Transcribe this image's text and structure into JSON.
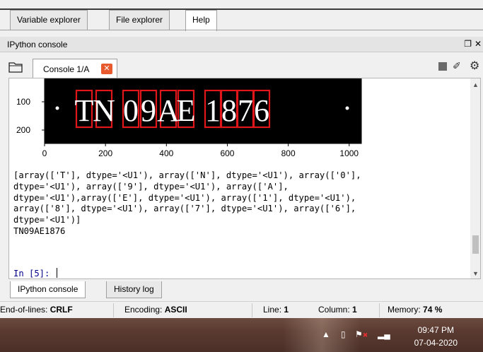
{
  "top_tabs": [
    {
      "label": "Variable explorer"
    },
    {
      "label": "File explorer"
    },
    {
      "label": "Help"
    }
  ],
  "pane": {
    "title": "IPython console",
    "undock_icon": "undock-icon",
    "close_icon": "close-icon"
  },
  "console_tab": {
    "label": "Console 1/A",
    "close_label": "✕"
  },
  "plot": {
    "plate_text": "TN 09 AE 1876",
    "characters": [
      "T",
      "N",
      "0",
      "9",
      "A",
      "E",
      "1",
      "8",
      "7",
      "6"
    ],
    "y_ticks": [
      "100",
      "200"
    ],
    "x_ticks": [
      "0",
      "200",
      "400",
      "600",
      "800",
      "1000"
    ]
  },
  "output": {
    "lines": [
      "[array(['T'], dtype='<U1'), array(['N'], dtype='<U1'), array(['0'],",
      "dtype='<U1'), array(['9'], dtype='<U1'), array(['A'],",
      "dtype='<U1'),array(['E'], dtype='<U1'), array(['1'], dtype='<U1'),",
      "array(['8'], dtype='<U1'), array(['7'], dtype='<U1'), array(['6'],",
      "dtype='<U1')]",
      "TN09AE1876"
    ],
    "prompt": "In [5]: "
  },
  "bottom_tabs": [
    {
      "label": "IPython console"
    },
    {
      "label": "History log"
    }
  ],
  "status": {
    "eol_label": "End-of-lines:",
    "eol_value": "CRLF",
    "encoding_label": "Encoding:",
    "encoding_value": "ASCII",
    "line_label": "Line:",
    "line_value": "1",
    "column_label": "Column:",
    "column_value": "1",
    "memory_label": "Memory:",
    "memory_value": "74 %"
  },
  "taskbar": {
    "time": "09:47 PM",
    "date": "07-04-2020"
  },
  "colors": {
    "box_red": "#e0161b",
    "prompt_blue": "#00008b",
    "close_orange": "#e85a2e"
  }
}
